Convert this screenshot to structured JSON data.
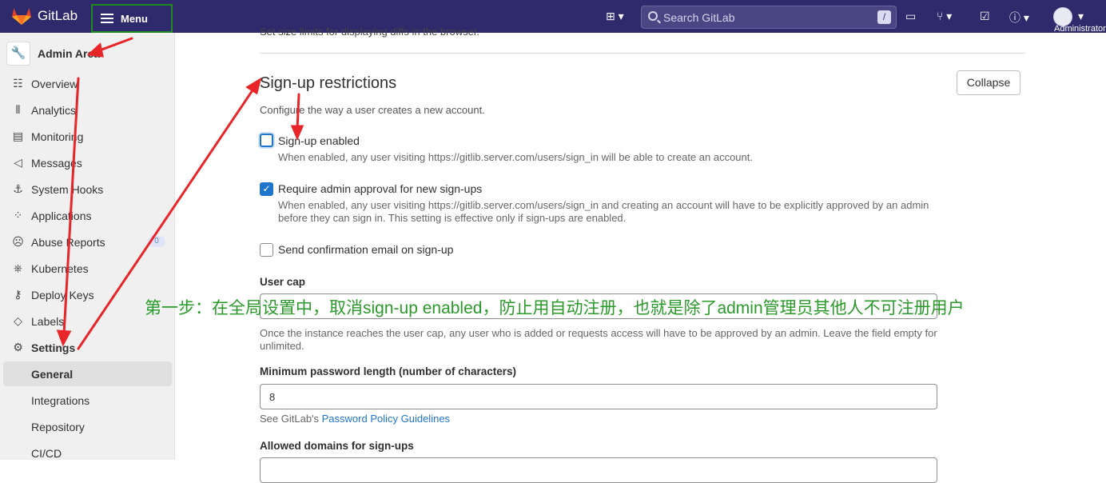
{
  "topbar": {
    "brand": "GitLab",
    "menu_label": "Menu",
    "search_placeholder": "Search GitLab",
    "search_shortcut": "/",
    "user_label": "Administrator"
  },
  "sidebar": {
    "area_title": "Admin Area",
    "items": [
      {
        "label": "Overview",
        "icon": "overview-icon"
      },
      {
        "label": "Analytics",
        "icon": "analytics-icon"
      },
      {
        "label": "Monitoring",
        "icon": "monitoring-icon"
      },
      {
        "label": "Messages",
        "icon": "megaphone-icon"
      },
      {
        "label": "System Hooks",
        "icon": "hook-icon"
      },
      {
        "label": "Applications",
        "icon": "applications-icon"
      },
      {
        "label": "Abuse Reports",
        "icon": "abuse-icon",
        "badge": "0"
      },
      {
        "label": "Kubernetes",
        "icon": "kubernetes-icon"
      },
      {
        "label": "Deploy Keys",
        "icon": "key-icon"
      },
      {
        "label": "Labels",
        "icon": "label-icon"
      },
      {
        "label": "Settings",
        "icon": "settings-icon"
      }
    ],
    "subitems": [
      "General",
      "Integrations",
      "Repository",
      "CI/CD"
    ]
  },
  "main": {
    "cut_text": "Set size limits for displaying diffs in the browser.",
    "section_title": "Sign-up restrictions",
    "collapse_label": "Collapse",
    "section_desc": "Configure the way a user creates a new account.",
    "signup_enabled": {
      "label": "Sign-up enabled",
      "help": "When enabled, any user visiting https://gitlib.server.com/users/sign_in will be able to create an account.",
      "checked": false
    },
    "admin_approval": {
      "label": "Require admin approval for new sign-ups",
      "help": "When enabled, any user visiting https://gitlib.server.com/users/sign_in and creating an account will have to be explicitly approved by an admin before they can sign in. This setting is effective only if sign-ups are enabled.",
      "checked": true
    },
    "confirmation_email": {
      "label": "Send confirmation email on sign-up",
      "checked": false
    },
    "user_cap": {
      "label": "User cap",
      "value": "",
      "help": "Once the instance reaches the user cap, any user who is added or requests access will have to be approved by an admin. Leave the field empty for unlimited."
    },
    "min_password": {
      "label": "Minimum password length (number of characters)",
      "value": "8",
      "help_prefix": "See GitLab's ",
      "help_link": "Password Policy Guidelines"
    },
    "allowed_domains_label": "Allowed domains for sign-ups"
  },
  "annotation": {
    "text": "第一步：在全局设置中，取消sign-up enabled，防止用自动注册，也就是除了admin管理员其他人不可注册用户",
    "color": "#2a9a2a",
    "arrow_color": "#e8262a"
  },
  "colors": {
    "topbar": "#2f2a6b",
    "accent": "#1f75cb"
  }
}
